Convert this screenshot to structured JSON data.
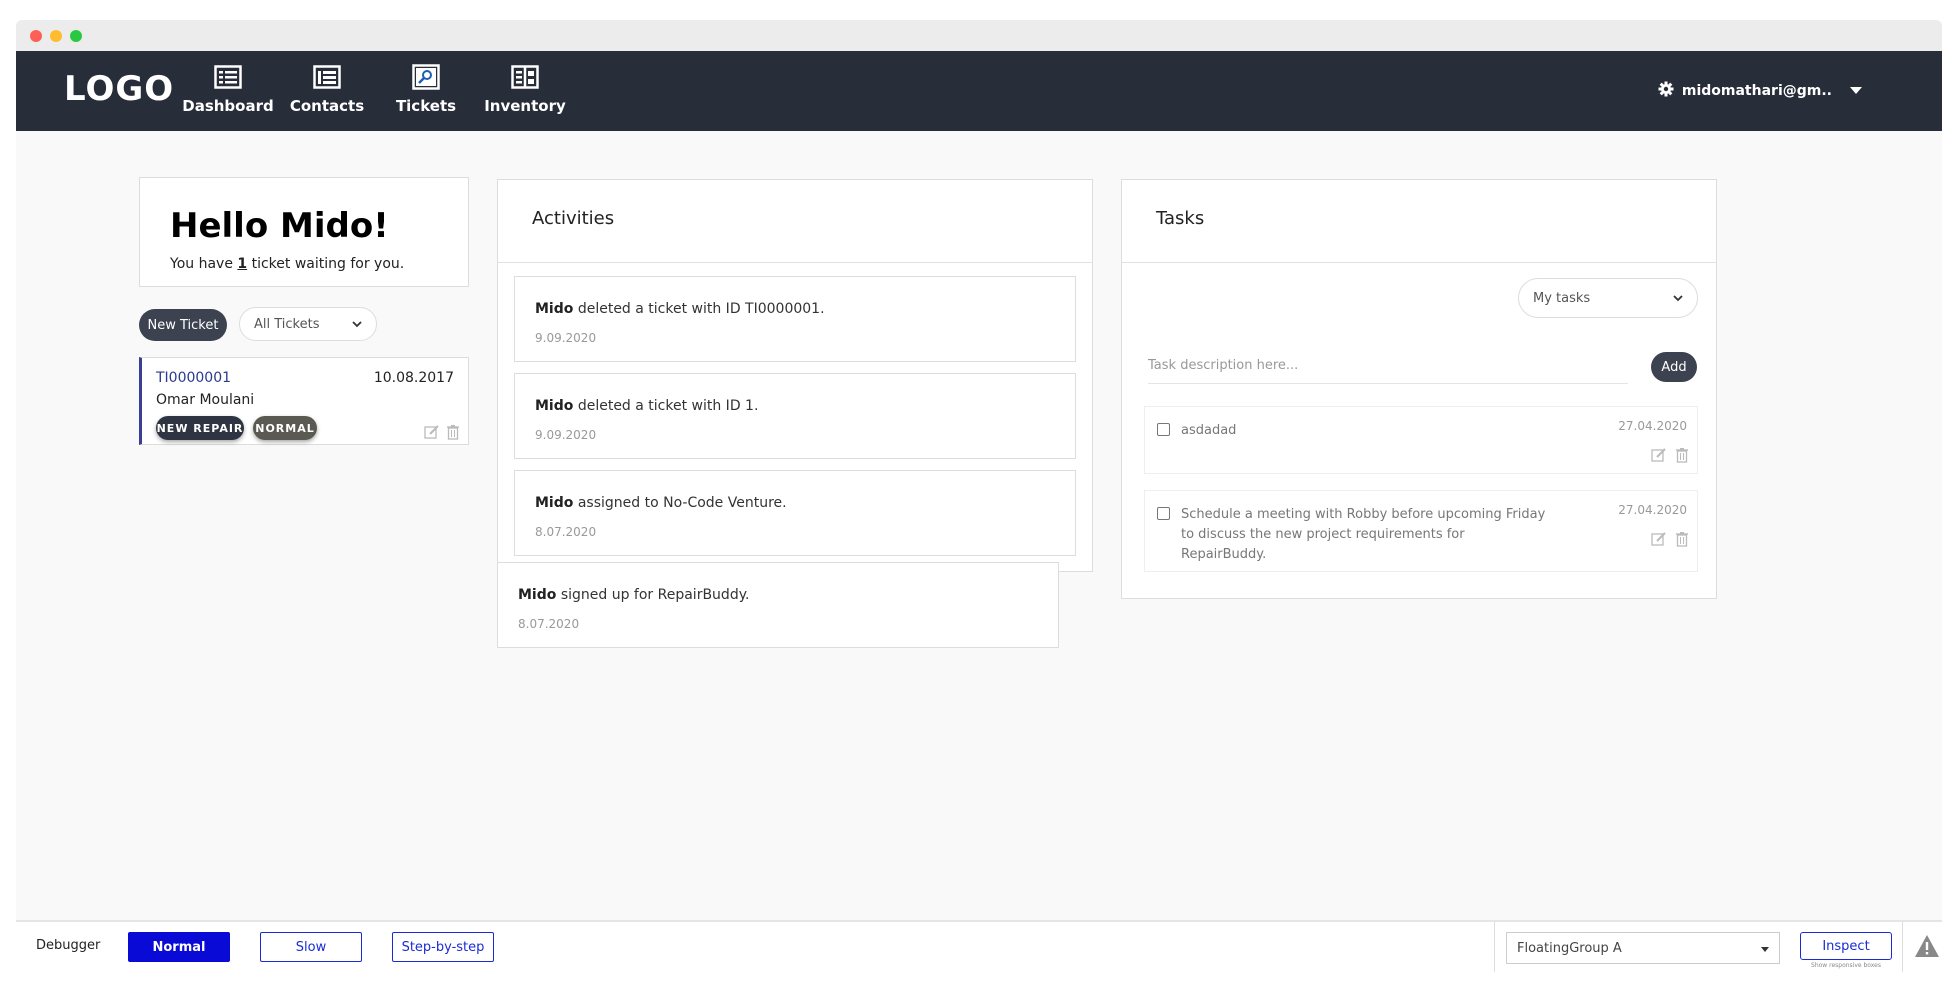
{
  "nav": {
    "logo": "LOGO",
    "items": [
      {
        "label": "Dashboard",
        "icon": "dashboard-icon"
      },
      {
        "label": "Contacts",
        "icon": "contacts-icon"
      },
      {
        "label": "Tickets",
        "icon": "tickets-icon"
      },
      {
        "label": "Inventory",
        "icon": "inventory-icon"
      }
    ],
    "user_email": "midomathari@gm.."
  },
  "greeting": {
    "title": "Hello Mido!",
    "before": "You have ",
    "count": "1",
    "after": " ticket waiting for you."
  },
  "tickets": {
    "new_button": "New Ticket",
    "filter_value": "All Tickets",
    "items": [
      {
        "id": "TI0000001",
        "date": "10.08.2017",
        "customer": "Omar Moulani",
        "type_badge": "NEW REPAIR",
        "priority_badge": "NORMAL"
      }
    ]
  },
  "activities": {
    "title": "Activities",
    "items": [
      {
        "actor": "Mido",
        "text": " deleted a ticket with ID TI0000001.",
        "date": "9.09.2020"
      },
      {
        "actor": "Mido",
        "text": " deleted a ticket with ID 1.",
        "date": "9.09.2020"
      },
      {
        "actor": "Mido",
        "text": " assigned to No-Code Venture.",
        "date": "8.07.2020"
      },
      {
        "actor": "Mido",
        "text": " signed up for RepairBuddy.",
        "date": "8.07.2020"
      }
    ]
  },
  "tasks": {
    "title": "Tasks",
    "filter_value": "My tasks",
    "input_placeholder": "Task description here...",
    "add_button": "Add",
    "items": [
      {
        "text": "asdadad",
        "date": "27.04.2020"
      },
      {
        "text": "Schedule a meeting with Robby before upcoming Friday to discuss the new project requirements for RepairBuddy.",
        "date": "27.04.2020"
      }
    ]
  },
  "debugger": {
    "label": "Debugger",
    "modes": [
      "Normal",
      "Slow",
      "Step-by-step"
    ],
    "active_mode": "Normal",
    "group_value": "FloatingGroup A",
    "inspect_label": "Inspect",
    "inspect_hint": "Show responsive boxes"
  },
  "colors": {
    "navbar": "#282d3a",
    "dark_button": "#3d4251",
    "badge_repair": "#2f3442",
    "badge_normal": "#5b5a52",
    "debug_active": "#0a0ad6"
  }
}
